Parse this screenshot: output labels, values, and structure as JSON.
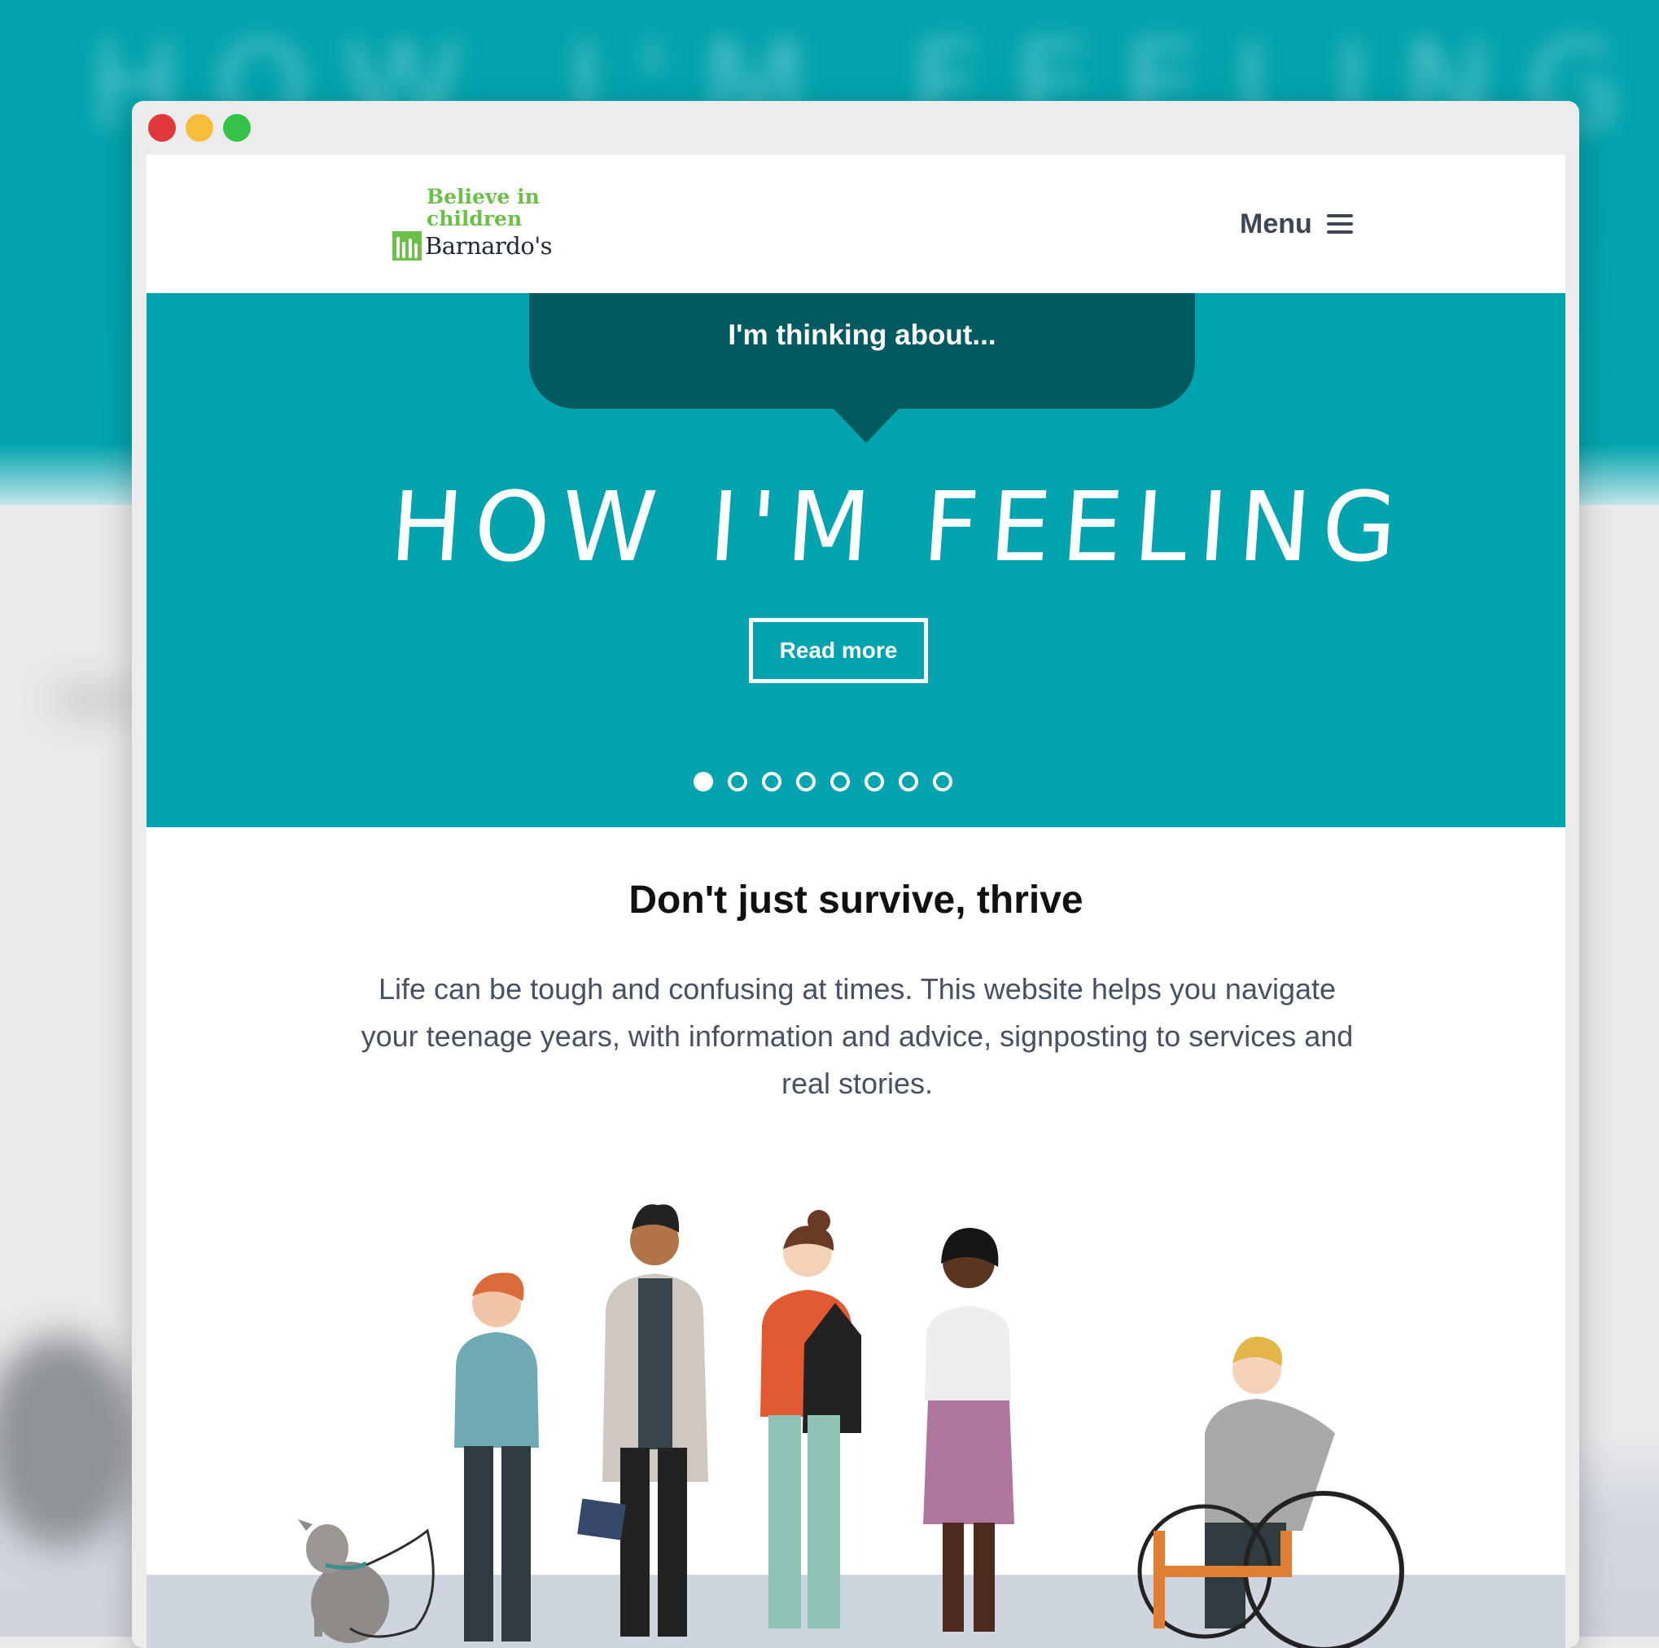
{
  "header": {
    "logo_tagline": "Believe in children",
    "logo_name": "Barnardo's",
    "menu_label": "Menu"
  },
  "hero": {
    "bubble_text": "I'm thinking about...",
    "title": "HOW I'M FEELING",
    "button_label": "Read more",
    "slides_total": 8,
    "active_slide": 1,
    "background_color": "#00a3ae",
    "bubble_color": "#025a61"
  },
  "intro": {
    "heading": "Don't just survive, thrive",
    "body": "Life can be tough and confusing at times. This website helps you navigate your teenage years, with information and advice, signposting to services and real stories."
  },
  "colors": {
    "logo_green": "#6cc04a",
    "menu_text": "#3d4654"
  },
  "icons": {
    "menu": "hamburger-icon",
    "window_controls": [
      "close-dot",
      "minimize-dot",
      "zoom-dot"
    ]
  }
}
